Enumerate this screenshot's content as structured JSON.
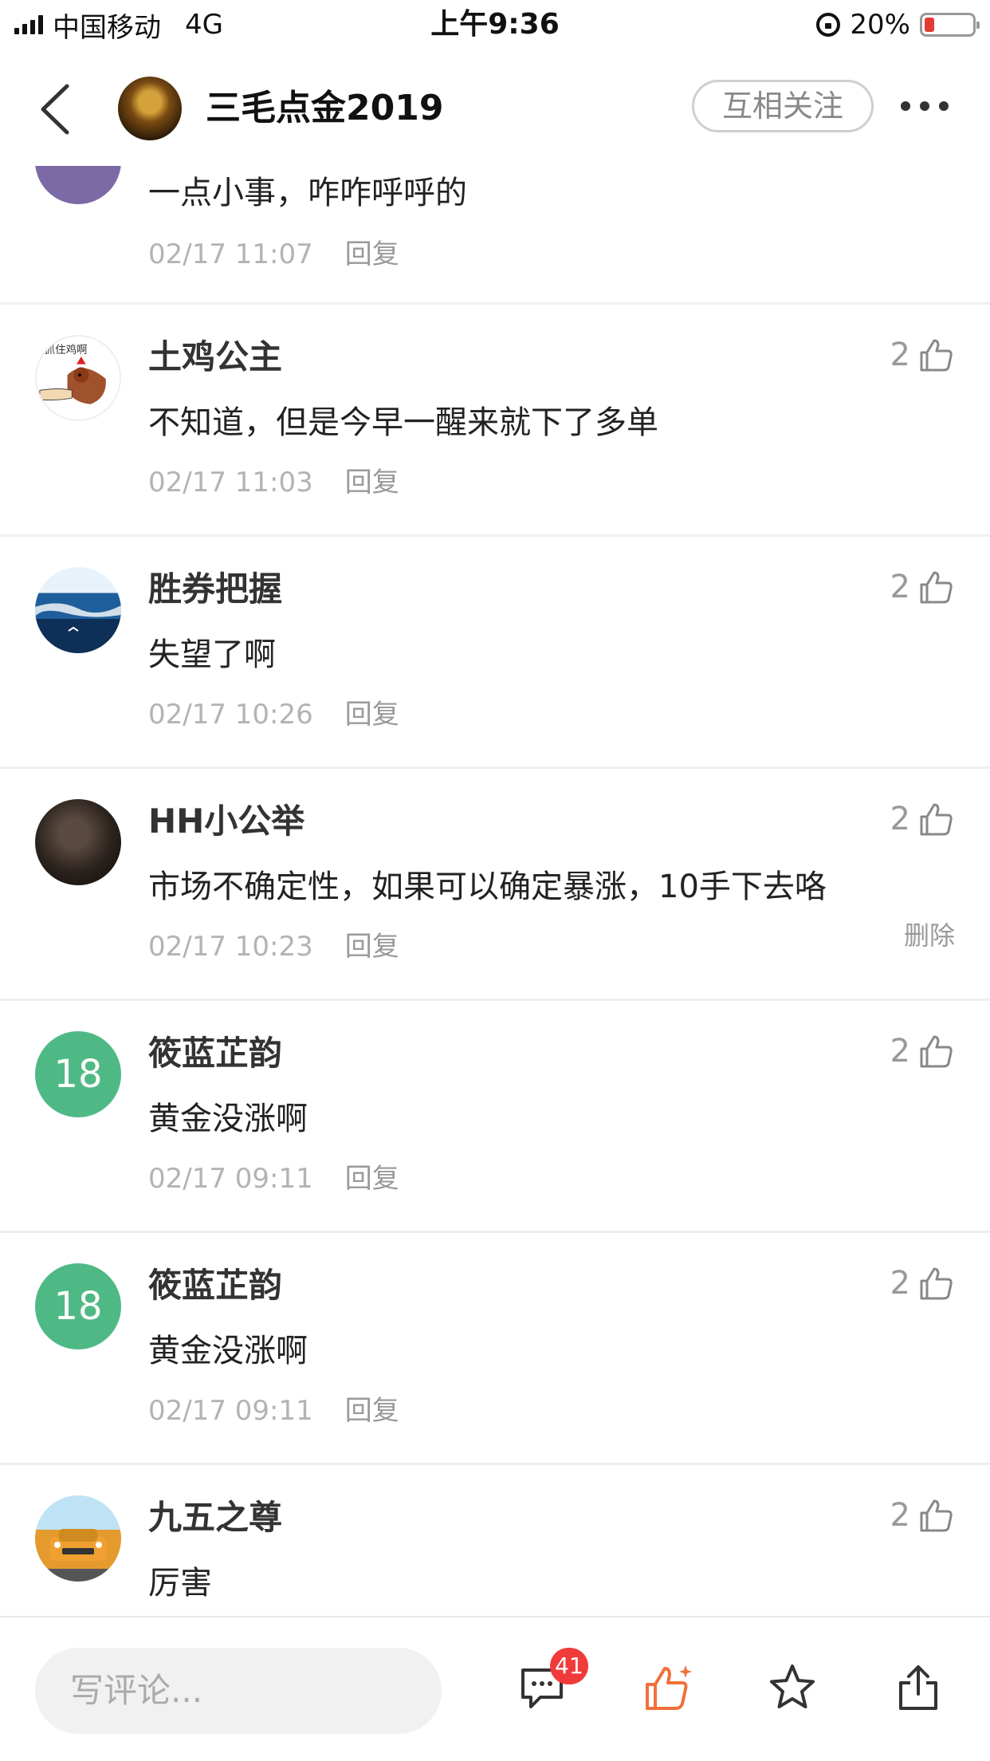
{
  "status_bar": {
    "carrier": "中国移动",
    "network": "4G",
    "time": "上午9:36",
    "battery": "20%",
    "battery_level": 0.2
  },
  "header": {
    "title": "三毛点金2019",
    "follow_label": "互相关注"
  },
  "comments": [
    {
      "username": "",
      "text": "一点小事，咋咋呼呼的",
      "time": "02/17 11:07",
      "reply": "回复",
      "likes": ""
    },
    {
      "username": "土鸡公主",
      "text": "不知道，但是今早一醒来就下了多单",
      "time": "02/17 11:03",
      "reply": "回复",
      "likes": "2",
      "avatar_text": "抓住鸡啊"
    },
    {
      "username": "胜券把握",
      "text": "失望了啊",
      "time": "02/17 10:26",
      "reply": "回复",
      "likes": "2"
    },
    {
      "username": "HH小公举",
      "text": "市场不确定性，如果可以确定暴涨，10手下去咯",
      "time": "02/17 10:23",
      "reply": "回复",
      "likes": "2",
      "delete": "删除"
    },
    {
      "username": "筱蓝芷韵",
      "text": "黄金没涨啊",
      "time": "02/17 09:11",
      "reply": "回复",
      "likes": "2",
      "avatar_number": "18"
    },
    {
      "username": "筱蓝芷韵",
      "text": "黄金没涨啊",
      "time": "02/17 09:11",
      "reply": "回复",
      "likes": "2",
      "avatar_number": "18"
    },
    {
      "username": "九五之尊",
      "text": "厉害",
      "time": "",
      "reply": "",
      "likes": "2"
    }
  ],
  "bottom_bar": {
    "input_placeholder": "写评论...",
    "comment_count": "41"
  },
  "colors": {
    "accent_like": "#f0703a",
    "badge": "#f03b3b",
    "number_avatar": "#4fb985"
  }
}
